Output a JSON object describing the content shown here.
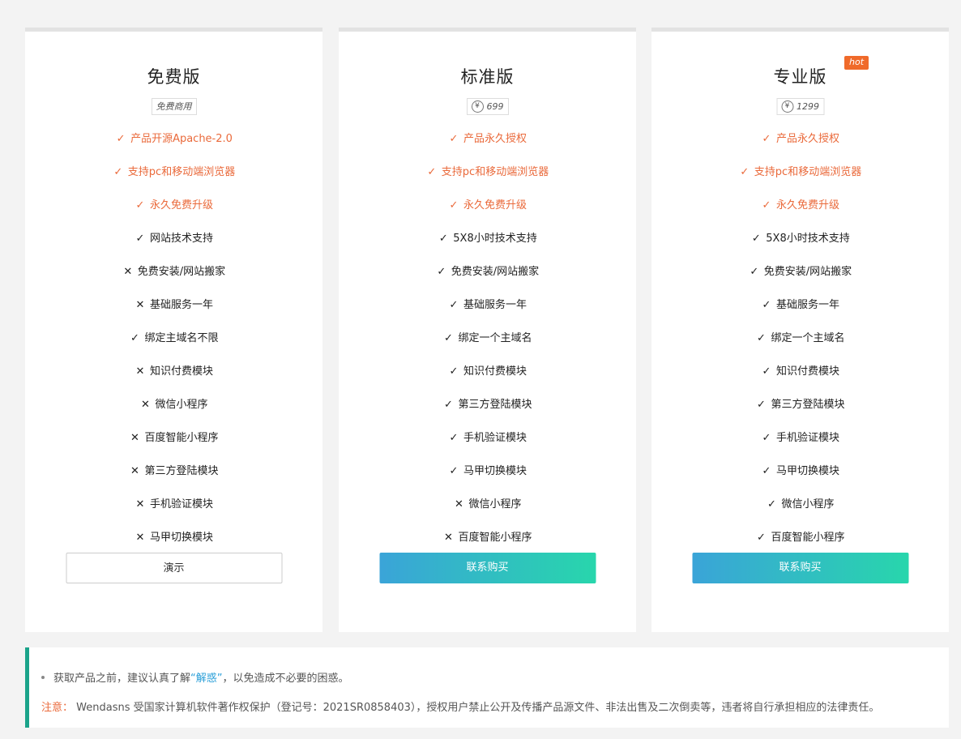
{
  "plans": [
    {
      "title": "免费版",
      "price_text": "免费商用",
      "show_yen": false,
      "hot": false,
      "features": [
        {
          "text": "产品开源Apache-2.0",
          "included": true,
          "highlight": true
        },
        {
          "text": "支持pc和移动端浏览器",
          "included": true,
          "highlight": true
        },
        {
          "text": "永久免费升级",
          "included": true,
          "highlight": true
        },
        {
          "text": "网站技术支持",
          "included": true,
          "highlight": false
        },
        {
          "text": "免费安装/网站搬家",
          "included": false,
          "highlight": false
        },
        {
          "text": "基础服务一年",
          "included": false,
          "highlight": false
        },
        {
          "text": "绑定主域名不限",
          "included": true,
          "highlight": false
        },
        {
          "text": "知识付费模块",
          "included": false,
          "highlight": false
        },
        {
          "text": "微信小程序",
          "included": false,
          "highlight": false
        },
        {
          "text": "百度智能小程序",
          "included": false,
          "highlight": false
        },
        {
          "text": "第三方登陆模块",
          "included": false,
          "highlight": false
        },
        {
          "text": "手机验证模块",
          "included": false,
          "highlight": false
        },
        {
          "text": "马甲切换模块",
          "included": false,
          "highlight": false
        }
      ],
      "button": {
        "label": "演示",
        "style": "outline"
      }
    },
    {
      "title": "标准版",
      "price_text": "699",
      "show_yen": true,
      "hot": false,
      "features": [
        {
          "text": "产品永久授权",
          "included": true,
          "highlight": true
        },
        {
          "text": "支持pc和移动端浏览器",
          "included": true,
          "highlight": true
        },
        {
          "text": "永久免费升级",
          "included": true,
          "highlight": true
        },
        {
          "text": "5X8小时技术支持",
          "included": true,
          "highlight": false
        },
        {
          "text": "免费安装/网站搬家",
          "included": true,
          "highlight": false
        },
        {
          "text": "基础服务一年",
          "included": true,
          "highlight": false
        },
        {
          "text": "绑定一个主域名",
          "included": true,
          "highlight": false
        },
        {
          "text": "知识付费模块",
          "included": true,
          "highlight": false
        },
        {
          "text": "第三方登陆模块",
          "included": true,
          "highlight": false
        },
        {
          "text": "手机验证模块",
          "included": true,
          "highlight": false
        },
        {
          "text": "马甲切换模块",
          "included": true,
          "highlight": false
        },
        {
          "text": "微信小程序",
          "included": false,
          "highlight": false
        },
        {
          "text": "百度智能小程序",
          "included": false,
          "highlight": false
        }
      ],
      "button": {
        "label": "联系购买",
        "style": "grad"
      }
    },
    {
      "title": "专业版",
      "price_text": "1299",
      "show_yen": true,
      "hot": true,
      "hot_label": "hot",
      "features": [
        {
          "text": "产品永久授权",
          "included": true,
          "highlight": true
        },
        {
          "text": "支持pc和移动端浏览器",
          "included": true,
          "highlight": true
        },
        {
          "text": "永久免费升级",
          "included": true,
          "highlight": true
        },
        {
          "text": "5X8小时技术支持",
          "included": true,
          "highlight": false
        },
        {
          "text": "免费安装/网站搬家",
          "included": true,
          "highlight": false
        },
        {
          "text": "基础服务一年",
          "included": true,
          "highlight": false
        },
        {
          "text": "绑定一个主域名",
          "included": true,
          "highlight": false
        },
        {
          "text": "知识付费模块",
          "included": true,
          "highlight": false
        },
        {
          "text": "第三方登陆模块",
          "included": true,
          "highlight": false
        },
        {
          "text": "手机验证模块",
          "included": true,
          "highlight": false
        },
        {
          "text": "马甲切换模块",
          "included": true,
          "highlight": false
        },
        {
          "text": "微信小程序",
          "included": true,
          "highlight": false
        },
        {
          "text": "百度智能小程序",
          "included": true,
          "highlight": false
        }
      ],
      "button": {
        "label": "联系购买",
        "style": "grad"
      }
    }
  ],
  "yen_symbol": "¥",
  "icons": {
    "check": "check-icon",
    "cross": "cross-icon"
  },
  "notice": {
    "tip_prefix": "获取产品之前，建议认真了解",
    "tip_link": "“解惑”",
    "tip_suffix": "，以免造成不必要的困惑。",
    "warn_label": "注意：",
    "warn_text": "Wendasns 受国家计算机软件著作权保护（登记号：2021SR0858403），授权用户禁止公开及传播产品源文件、非法出售及二次倒卖等，违者将自行承担相应的法律责任。"
  },
  "colors": {
    "accent": "#ea6a3b",
    "link": "#2a9fd8",
    "notice_border": "#1aa38a",
    "grad_start": "#3aa4d8",
    "grad_end": "#28d6ac"
  }
}
